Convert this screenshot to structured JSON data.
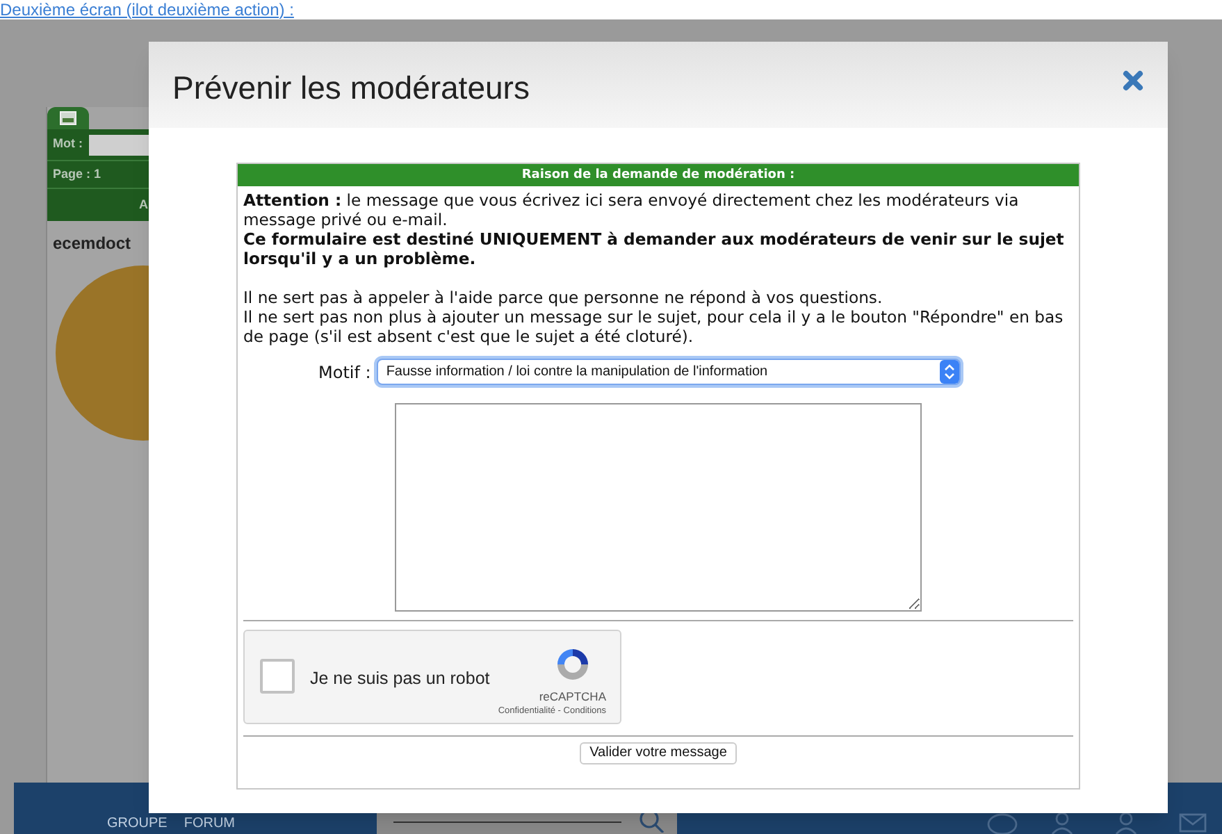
{
  "page_link": "Deuxième écran (ilot deuxième action) :",
  "sidebar": {
    "word_label": "Mot :",
    "page_label": "Page : 1",
    "header_fragment": "A",
    "username": "ecemdoct"
  },
  "nav": {
    "items": [
      "GROUPE",
      "FORUM"
    ]
  },
  "dialog": {
    "title": "Prévenir les modérateurs",
    "form": {
      "heading": "Raison de la demande de modération :",
      "paragraphs": [
        {
          "kind": "notice",
          "text": "**Attention :** le message que vous écrivez ici sera envoyé directement chez les modérateurs via message privé ou e-mail."
        },
        {
          "kind": "warning",
          "text": "Ce formulaire est destiné UNIQUEMENT à demander aux modérateurs de venir sur le sujet lorsqu'il y a un problème."
        },
        {
          "kind": "info",
          "text": "Il ne sert pas à appeler à l'aide parce que personne ne répond à vos questions."
        },
        {
          "kind": "info",
          "text": "Il ne sert pas non plus à ajouter un message sur le sujet, pour cela il y a le bouton \"Répondre\" en bas de page (s'il est absent c'est que le sujet a été cloturé)."
        }
      ],
      "motif_label": "Motif :",
      "motif_value": "Fausse information / loi contre la manipulation de l'information",
      "captcha": {
        "label": "Je ne suis pas un robot",
        "checked": false,
        "brand": "reCAPTCHA",
        "links": "Confidentialité - Conditions"
      },
      "submit": "Valider votre message"
    }
  }
}
